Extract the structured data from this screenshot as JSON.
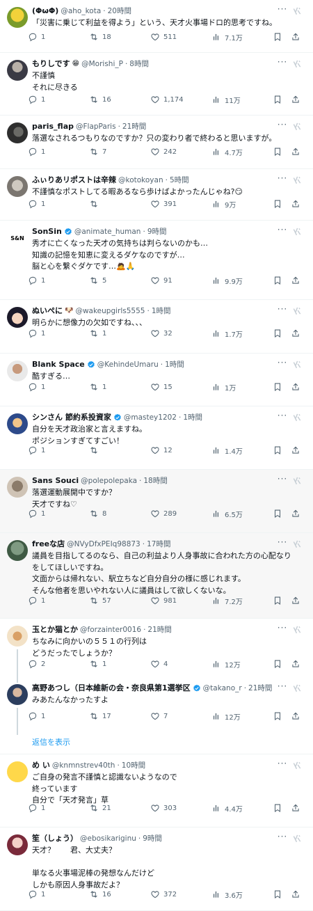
{
  "colors": {
    "accent": "#1d9bf0",
    "muted": "#536471",
    "text": "#0f1419",
    "verified": "#1d9bf0"
  },
  "tweets": [
    {
      "name": "(ΦωΦ)",
      "handle": "@aho_kota",
      "time": "20時間",
      "verified": false,
      "avatar_icon": "cartoon-character-avatar",
      "lines": [
        "「災害に乗じて利益を得よう」という、天才火事場ドロ的思考ですね。"
      ],
      "replies": "1",
      "retweets": "18",
      "likes": "511",
      "views": "7.1万"
    },
    {
      "name": "もりしです",
      "name_emoji": "😁",
      "handle": "@Morishi_P",
      "time": "8時間",
      "verified": false,
      "avatar_icon": "person-photo-avatar",
      "lines": [
        "不謹慎",
        "それに尽きる"
      ],
      "replies": "1",
      "retweets": "16",
      "likes": "1,174",
      "views": "11万"
    },
    {
      "name": "paris_flap",
      "handle": "@FlapParis",
      "time": "21時間",
      "verified": false,
      "avatar_icon": "bird-photo-avatar",
      "lines": [
        "落選なされるつもりなのですか？只の変わり者で終わると思いますが。"
      ],
      "replies": "1",
      "retweets": "7",
      "likes": "242",
      "views": "4.7万"
    },
    {
      "name": "ふぃりあリポストは辛辣",
      "handle": "@kotokoyan",
      "time": "5時間",
      "verified": false,
      "avatar_icon": "cat-photo-avatar",
      "lines": [
        "不謹慎なポストしてる暇あるなら歩けばよかったんじゃね?😏"
      ],
      "replies": "1",
      "retweets": "",
      "likes": "391",
      "views": "9万"
    },
    {
      "name": "SonSin",
      "handle": "@animate_human",
      "time": "9時間",
      "verified": true,
      "avatar_icon": "son-sin-logo-avatar",
      "avatar_text": "S&N",
      "lines": [
        "秀才に亡くなった天才の気持ちは判らないのかも…",
        "知識の記憶を知恵に変えるダケなのですが…",
        "脳と心を繋ぐダケです…🙇🙏"
      ],
      "replies": "1",
      "retweets": "5",
      "likes": "91",
      "views": "9.9万"
    },
    {
      "name": "ぬいぺに",
      "name_emoji": "🐶",
      "handle": "@wakeupgirls5555",
      "time": "1時間",
      "verified": false,
      "avatar_icon": "anime-girl-avatar",
      "lines": [
        "明らかに想像力の欠如ですね、、、"
      ],
      "replies": "1",
      "retweets": "1",
      "likes": "32",
      "views": "1.7万"
    },
    {
      "name": "Blank Space",
      "handle": "@KehindeUmaru",
      "time": "1時間",
      "verified": true,
      "avatar_icon": "man-photo-avatar",
      "lines": [
        "酷すぎる…"
      ],
      "replies": "1",
      "retweets": "1",
      "likes": "15",
      "views": "1万"
    },
    {
      "name": "シンさん 節約系投資家",
      "handle": "@mastey1202",
      "time": "1時間",
      "verified": true,
      "avatar_icon": "illustration-avatar",
      "lines": [
        "自分を天才政治家と言えますね。",
        "ポジションすぎてすごい！"
      ],
      "replies": "1",
      "retweets": "",
      "likes": "12",
      "views": "1.4万"
    },
    {
      "name": "Sans Souci",
      "handle": "@polepolepaka",
      "time": "18時間",
      "verified": false,
      "avatar_icon": "kitten-photo-avatar",
      "lines": [
        "落選運動展開中ですか？",
        "天才ですね♡"
      ],
      "replies": "1",
      "retweets": "8",
      "likes": "289",
      "views": "6.5万"
    },
    {
      "name": "freeな店",
      "handle": "@NVyDfxPEIq98873",
      "time": "17時間",
      "verified": false,
      "avatar_icon": "landscape-photo-avatar",
      "lines": [
        "議員を目指してるのなら、自己の利益より人身事故に合われた方の心配なり",
        "をしてほしいですね。",
        "文面からは帰れない、駅立ちなど自分自分の様に感じれます。",
        "そんな他者を思いやれない人に議員はして欲しくないな。"
      ],
      "replies": "1",
      "retweets": "57",
      "likes": "981",
      "views": "7.2万"
    },
    {
      "name": "玉とか猫とか",
      "handle": "@forzainter0016",
      "time": "21時間",
      "verified": false,
      "avatar_icon": "pizza-photo-avatar",
      "lines": [
        "ちなみに向かいの５５１の行列は",
        "どうだったでしょうか？"
      ],
      "replies": "2",
      "retweets": "1",
      "likes": "4",
      "views": "12万"
    },
    {
      "name": "高野あつし（日本維新の会・奈良県第1選挙区",
      "handle": "@takano_r",
      "time": "21時間",
      "verified": true,
      "avatar_icon": "politician-photo-avatar",
      "lines": [
        "みあたんなかったすよ"
      ],
      "replies": "1",
      "retweets": "17",
      "likes": "7",
      "views": "12万"
    },
    {
      "name": "め い",
      "handle": "@knmnstrev40th",
      "time": "10時間",
      "verified": false,
      "avatar_icon": "smiley-face-avatar",
      "lines": [
        "ご自身の発言不謹慎と認識ないようなので",
        "終っています",
        "自分で「天才発言」草"
      ],
      "replies": "1",
      "retweets": "21",
      "likes": "303",
      "views": "4.4万"
    },
    {
      "name": "笙（しょう）",
      "handle": "@ebosikariginu",
      "time": "9時間",
      "verified": false,
      "avatar_icon": "anime-character-avatar",
      "lines": [
        "天才？　　君、大丈夫？",
        "",
        "単なる火事場泥棒の発想なんだけど",
        "しかも原因人身事故だよ？"
      ],
      "replies": "1",
      "retweets": "16",
      "likes": "372",
      "views": "3.6万"
    }
  ],
  "show_replies_label": "返信を表示"
}
